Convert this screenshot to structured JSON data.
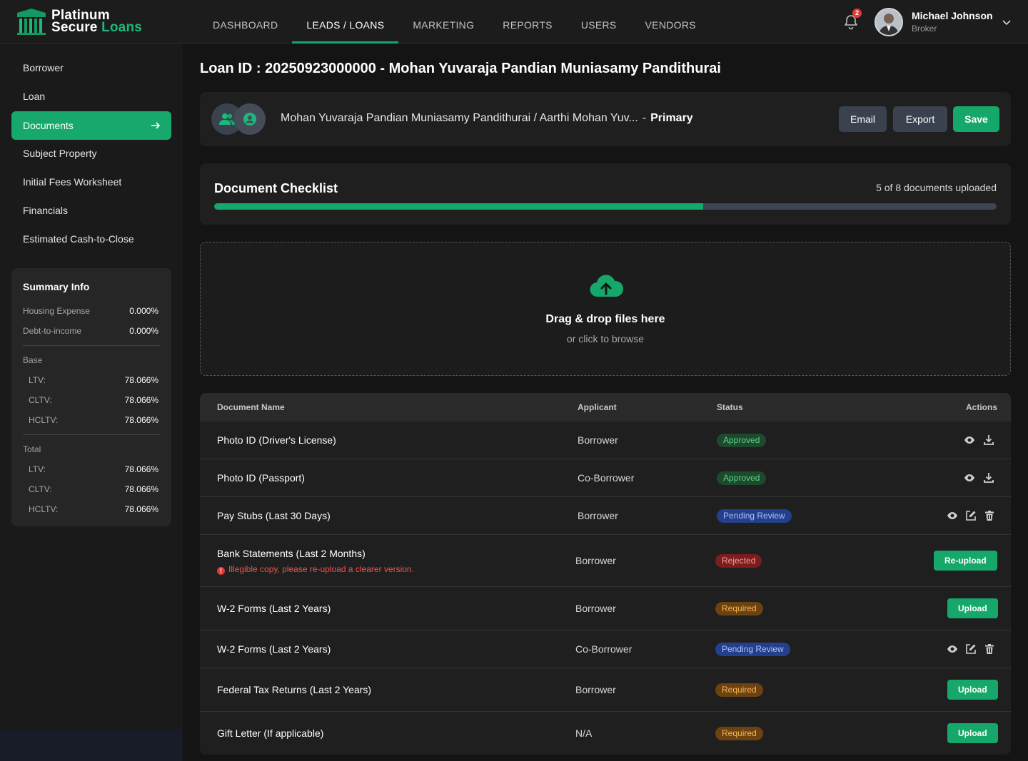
{
  "app": {
    "logo_line1": "Platinum",
    "logo_line2a": "Secure",
    "logo_line2b": "Loans",
    "brand_color": "#16a86a"
  },
  "nav": {
    "items": [
      "DASHBOARD",
      "LEADS / LOANS",
      "MARKETING",
      "REPORTS",
      "USERS",
      "VENDORS"
    ],
    "active": "LEADS / LOANS"
  },
  "user": {
    "notifications": "2",
    "name": "Michael Johnson",
    "role": "Broker"
  },
  "sidebar": {
    "items": [
      "Borrower",
      "Loan",
      "Documents",
      "Subject Property",
      "Initial Fees Worksheet",
      "Financials",
      "Estimated Cash-to-Close"
    ],
    "active": "Documents"
  },
  "summary": {
    "title": "Summary Info",
    "housing_label": "Housing Expense",
    "housing_value": "0.000%",
    "dti_label": "Debt-to-income",
    "dti_value": "0.000%",
    "base_label": "Base",
    "base": [
      {
        "label": "LTV:",
        "value": "78.066%"
      },
      {
        "label": "CLTV:",
        "value": "78.066%"
      },
      {
        "label": "HCLTV:",
        "value": "78.066%"
      }
    ],
    "total_label": "Total",
    "total": [
      {
        "label": "LTV:",
        "value": "78.066%"
      },
      {
        "label": "CLTV:",
        "value": "78.066%"
      },
      {
        "label": "HCLTV:",
        "value": "78.066%"
      }
    ]
  },
  "page": {
    "title": "Loan ID : 20250923000000 - Mohan Yuvaraja Pandian Muniasamy Pandithurai"
  },
  "borrower": {
    "names": "Mohan Yuvaraja Pandian Muniasamy Pandithurai / Aarthi Mohan Yuv...",
    "dash": "-",
    "primary": "Primary",
    "email_label": "Email",
    "export_label": "Export",
    "save_label": "Save"
  },
  "checklist": {
    "title": "Document Checklist",
    "count_text": "5 of 8 documents uploaded",
    "progress": 0.625
  },
  "dropzone": {
    "title": "Drag & drop files here",
    "subtitle": "or click to browse"
  },
  "table": {
    "headers": {
      "name": "Document Name",
      "applicant": "Applicant",
      "status": "Status",
      "actions": "Actions"
    },
    "rows": [
      {
        "name": "Photo ID (Driver's License)",
        "applicant": "Borrower",
        "status": "Approved"
      },
      {
        "name": "Photo ID (Passport)",
        "applicant": "Co-Borrower",
        "status": "Approved"
      },
      {
        "name": "Pay Stubs (Last 30 Days)",
        "applicant": "Borrower",
        "status": "Pending Review"
      },
      {
        "name": "Bank Statements (Last 2 Months)",
        "applicant": "Borrower",
        "status": "Rejected",
        "error": "Illegible copy, please re-upload a clearer version.",
        "action": "Re-upload"
      },
      {
        "name": "W-2 Forms (Last 2 Years)",
        "applicant": "Borrower",
        "status": "Required",
        "action": "Upload"
      },
      {
        "name": "W-2 Forms (Last 2 Years)",
        "applicant": "Co-Borrower",
        "status": "Pending Review"
      },
      {
        "name": "Federal Tax Returns (Last 2 Years)",
        "applicant": "Borrower",
        "status": "Required",
        "action": "Upload"
      },
      {
        "name": "Gift Letter (If applicable)",
        "applicant": "N/A",
        "status": "Required",
        "action": "Upload"
      }
    ]
  }
}
